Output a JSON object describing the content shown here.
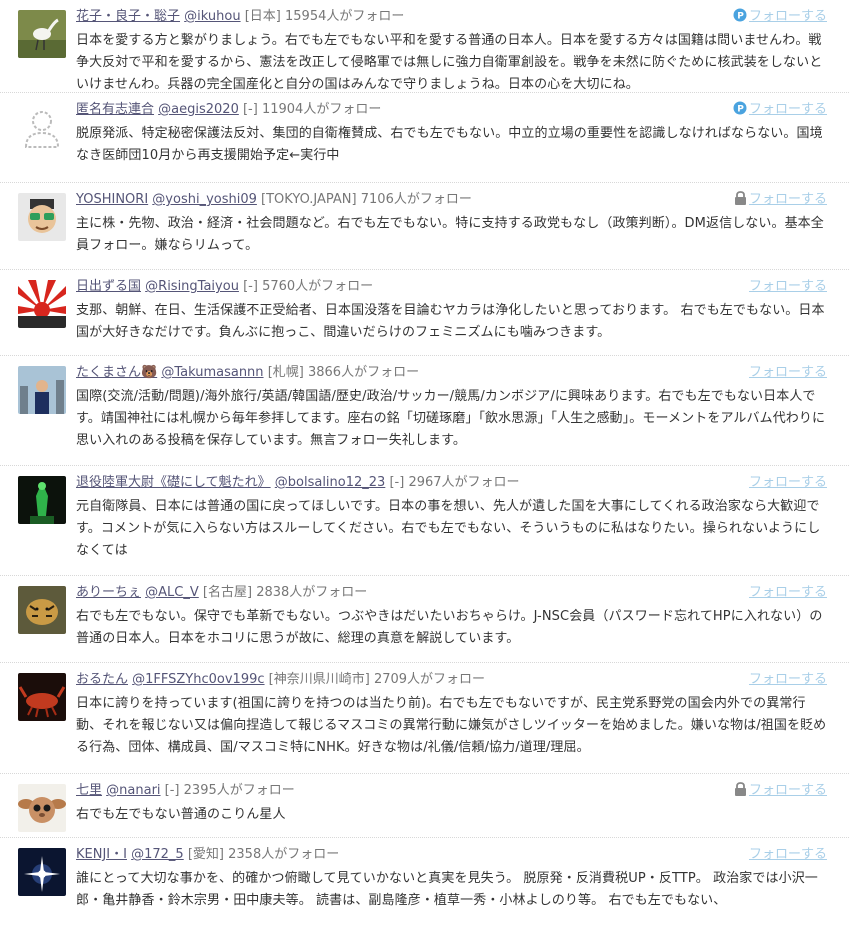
{
  "follow_label": "フォローする",
  "users": [
    {
      "name": "花子・良子・聡子",
      "screen_name": "@ikuhou",
      "location": "[日本]",
      "followers": "15954人がフォロー",
      "follow_icon": "p-icon",
      "bio": "日本を愛する方と繋がりましょう。右でも左でもない平和を愛する普通の日本人。日本を愛する方々は国籍は問いませんわ。戦争大反対で平和を愛するから、憲法を改正して侵略軍では無しに強力自衛軍創設を。戦争を未然に防ぐために核武装をしないといけませんわ。兵器の完全国産化と自分の国はみんなで守りましょうね。日本の心を大切にね。",
      "avatar": "egret"
    },
    {
      "name": "匿名有志連合",
      "screen_name": "@aegis2020",
      "location": "[-]",
      "followers": "11904人がフォロー",
      "follow_icon": "p-icon",
      "bio": "脱原発派、特定秘密保護法反対、集団的自衛権賛成、右でも左でもない。中立的立場の重要性を認識しなければならない。国境なき医師団10月から再支援開始予定←実行中",
      "avatar": "default"
    },
    {
      "name": "YOSHINORI",
      "screen_name": "@yoshi_yoshi09",
      "location": "[TOKYO.JAPAN]",
      "followers": "7106人がフォロー",
      "follow_icon": "lock-icon",
      "bio": "主に株・先物、政治・経済・社会問題など。右でも左でもない。特に支持する政党もなし（政策判断）。DM返信しない。基本全員フォロー。嫌ならリムって。",
      "avatar": "cartoon"
    },
    {
      "name": "日出ずる国",
      "screen_name": "@RisingTaiyou",
      "location": "[-]",
      "followers": "5760人がフォロー",
      "follow_icon": "",
      "bio": "支那、朝鮮、在日、生活保護不正受給者、日本国没落を目論むヤカラは浄化したいと思っております。 右でも左でもない。日本国が大好きなだけです。負んぶに抱っこ、間違いだらけのフェミニズムにも噛みつきます。",
      "avatar": "rising-sun"
    },
    {
      "name": "たくまさん🐻",
      "screen_name": "@Takumasannn",
      "location": "[札幌]",
      "followers": "3866人がフォロー",
      "follow_icon": "",
      "bio": "国際(交流/活動/問題)/海外旅行/英語/韓国語/歴史/政治/サッカー/競馬/カンボジア/に興味あります。右でも左でもない日本人です。靖国神社には札幌から毎年参拝してます。座右の銘「切磋琢磨」「飲水思源」「人生之感動」。モーメントをアルバム代わりに思い入れのある投稿を保存しています。無言フォロー失礼します。",
      "avatar": "city"
    },
    {
      "name": "退役陸軍大尉《礎にして魁たれ》",
      "screen_name": "@bolsalino12_23",
      "location": "[-]",
      "followers": "2967人がフォロー",
      "follow_icon": "",
      "bio": "元自衛隊員、日本には普通の国に戻ってほしいです。日本の事を想い、先人が遺した国を大事にしてくれる政治家なら大歓迎です。コメントが気に入らない方はスルーしてください。右でも左でもない、そういうものに私はなりたい。操られないようにしなくては",
      "avatar": "green-statue"
    },
    {
      "name": "ありーちぇ",
      "screen_name": "@ALC_V",
      "location": "[名古屋]",
      "followers": "2838人がフォロー",
      "follow_icon": "",
      "bio": "右でも左でもない。保守でも革新でもない。つぶやきはだいたいおちゃらけ。J-NSC会員（パスワード忘れてHPに入れない）の普通の日本人。日本をホコリに思うが故に、総理の真意を解説しています。",
      "avatar": "tiger"
    },
    {
      "name": "おるたん",
      "screen_name": "@1FFSZYhc0ov199c",
      "location": "[神奈川県川崎市]",
      "followers": "2709人がフォロー",
      "follow_icon": "",
      "bio": "日本に誇りを持っています(祖国に誇りを持つのは当たり前)。右でも左でもないですが、民主党系野党の国会内外での異常行動、それを報じない又は偏向捏造して報じるマスコミの異常行動に嫌気がさしツイッターを始めました。嫌いな物は/祖国を貶める行為、団体、構成員、国/マスコミ特にNHK。好きな物は/礼儀/信頼/協力/道理/理屈。",
      "avatar": "lobster"
    },
    {
      "name": "七里",
      "screen_name": "@nanari",
      "location": "[-]",
      "followers": "2395人がフォロー",
      "follow_icon": "lock-icon",
      "bio": "右でも左でもない普通のこりん星人",
      "avatar": "gremlin"
    },
    {
      "name": "KENJI・I",
      "screen_name": "@172_5",
      "location": "[愛知]",
      "followers": "2358人がフォロー",
      "follow_icon": "",
      "bio": "誰にとって大切な事かを、的確かつ俯瞰して見ていかないと真実を見失う。 脱原発・反消費税UP・反TTP。 政治家では小沢一郎・亀井静香・鈴木宗男・田中康夫等。 読書は、副島隆彦・植草一秀・小林よしのり等。 右でも左でもない、",
      "avatar": "starburst"
    }
  ]
}
